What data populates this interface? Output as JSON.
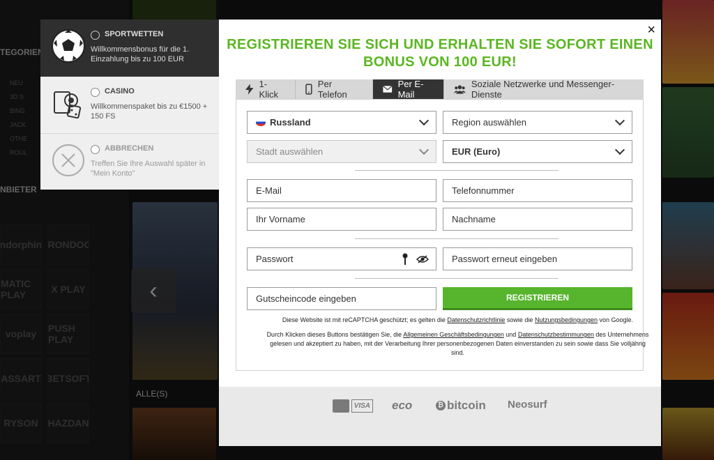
{
  "background": {
    "categories_label": "TEGORIEN",
    "sub_items": [
      "NEU",
      "3D S",
      "BING",
      "JACK",
      "OTHE",
      "ROUL"
    ],
    "providers_label": "NBIETER",
    "providers": [
      "endorphina",
      "IRONDOG",
      "MATIC PLAY",
      "X PLAY",
      "voplay",
      "PUSH PLAY",
      "ASSART",
      "BETSOFT",
      "RYSON",
      "HAZDAN"
    ],
    "alle_label": "ALLE(S)"
  },
  "bonus": {
    "options": [
      {
        "title": "SPORTWETTEN",
        "desc": "Willkommensbonus für die 1. Einzahlung bis zu 100 EUR",
        "icon": "soccer-ball-icon",
        "state": "selected"
      },
      {
        "title": "CASINO",
        "desc": "Willkommenspaket bis zu €1500 + 150 FS",
        "icon": "casino-chips-icon",
        "state": "normal"
      },
      {
        "title": "ABBRECHEN",
        "desc": "Treffen Sie Ihre Auswahl später in \"Mein Konto\"",
        "icon": "cancel-circle-icon",
        "state": "muted"
      }
    ]
  },
  "modal": {
    "close": "×",
    "heading_line1": "REGISTRIEREN SIE SICH UND ERHALTEN SIE SOFORT EINEN",
    "heading_line2": "BONUS VON 100 EUR!",
    "tabs": [
      {
        "label": "1-Klick",
        "icon": "lightning-icon",
        "active": false
      },
      {
        "label": "Per Telefon",
        "icon": "phone-icon",
        "active": false
      },
      {
        "label": "Per E-Mail",
        "icon": "envelope-icon",
        "active": true
      },
      {
        "label": "Soziale Netzwerke und Messenger-Dienste",
        "icon": "people-icon",
        "active": false
      }
    ],
    "country": "Russland",
    "region": "Region auswählen",
    "city": "Stadt auswählen",
    "currency": "EUR (Euro)",
    "email": "E-Mail",
    "phone": "Telefonnummer",
    "first_name": "Ihr Vorname",
    "last_name": "Nachname",
    "password": "Passwort",
    "password_repeat": "Passwort erneut eingeben",
    "promo": "Gutscheincode eingeben",
    "register": "REGISTRIEREN",
    "recaptcha_pre": "Diese Website ist mit reCAPTCHA geschützt; es gelten die ",
    "recaptcha_link1": "Datenschutzrichtlinie",
    "recaptcha_mid": " sowie die ",
    "recaptcha_link2": "Nutzungsbedingungen",
    "recaptcha_post": " von Google.",
    "terms_pre": "Durch Klicken dieses Buttons bestätigen Sie, die ",
    "terms_link1": "Allgemeinen Geschäftsbedingungen",
    "terms_mid": " und ",
    "terms_link2": "Datenschutzbestimmungen",
    "terms_post": " des Unternehmens gelesen und akzeptiert zu haben, mit der Verarbeitung Ihrer personenbezogenen Daten einverstanden zu sein sowie dass Sie volljährig sind."
  },
  "payments": {
    "visa": "VISA",
    "eco": "eco",
    "bitcoin": "bitcoin",
    "neosurf": "Neosurf"
  },
  "colors": {
    "accent_green": "#5bb621",
    "button_green": "#57b42d"
  }
}
